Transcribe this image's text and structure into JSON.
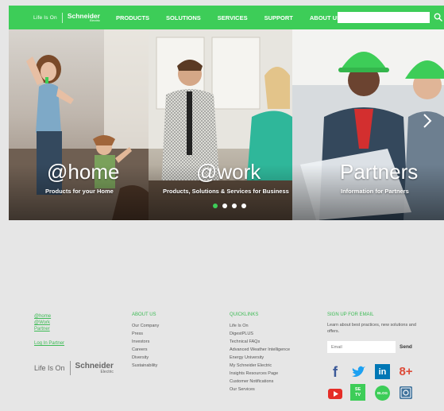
{
  "header": {
    "brand_tagline": "Life Is On",
    "brand_name": "Schneider",
    "brand_sub": "Electric",
    "nav": [
      "PRODUCTS",
      "SOLUTIONS",
      "SERVICES",
      "SUPPORT",
      "ABOUT US"
    ],
    "search_placeholder": "",
    "accent_color": "#3dcd58"
  },
  "hero": {
    "panels": [
      {
        "title": "@home",
        "subtitle": "Products for your Home"
      },
      {
        "title": "@work",
        "subtitle": "Products, Solutions & Services for Business"
      },
      {
        "title": "Partners",
        "subtitle": "Information for Partners"
      }
    ],
    "carousel_dots": 4,
    "active_dot": 1
  },
  "footer": {
    "quick": [
      "@home",
      "@Work",
      "Partner"
    ],
    "log_in": "Log In Partner",
    "about": {
      "heading": "ABOUT US",
      "items": [
        "Our Company",
        "Press",
        "Investors",
        "Careers",
        "Diversity",
        "Sustainability"
      ]
    },
    "quicklinks": {
      "heading": "QUICKLINKS",
      "items": [
        "Life Is On",
        "DigestPLUS",
        "Technical FAQs",
        "Advanced Weather Intelligence",
        "Energy University",
        "My Schneider Electric",
        "Insights Resources Page",
        "Customer Notifications",
        "Our Services"
      ]
    },
    "signup": {
      "heading": "SIGN UP FOR EMAIL",
      "text": "Learn about best practices, new solutions and offers.",
      "email_placeholder": "Email",
      "send_label": "Send"
    },
    "brand_tagline": "Life Is On",
    "brand_name": "Schneider",
    "brand_sub": "Electric",
    "social": [
      "facebook-icon",
      "twitter-icon",
      "linkedin-icon",
      "google-plus-icon",
      "youtube-icon",
      "se-tv-icon",
      "blog-icon",
      "instagram-icon"
    ],
    "social_labels": {
      "se_tv_1": "SE",
      "se_tv_2": "TV",
      "blog": "BLOG"
    }
  }
}
